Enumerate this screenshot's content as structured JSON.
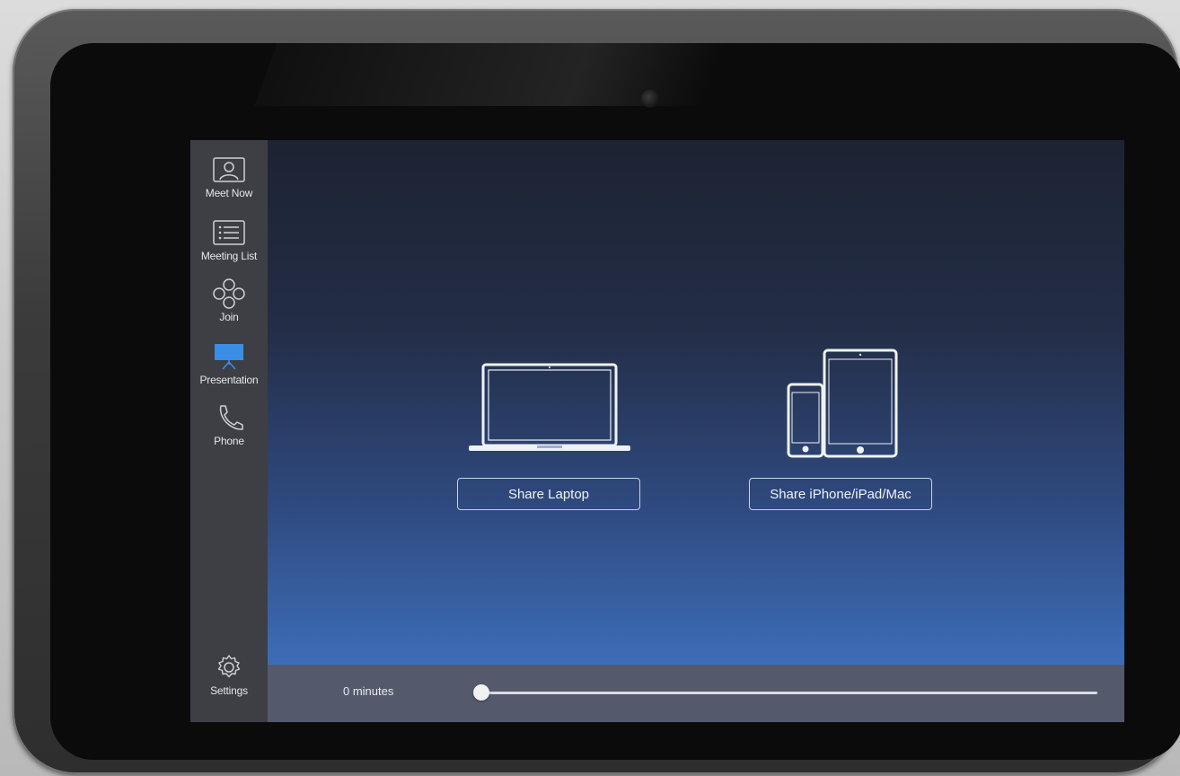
{
  "sidebar": {
    "items": [
      {
        "label": "Meet Now",
        "icon": "contact-card-icon",
        "active": false
      },
      {
        "label": "Meeting List",
        "icon": "list-icon",
        "active": false
      },
      {
        "label": "Join",
        "icon": "join-icon",
        "active": false
      },
      {
        "label": "Presentation",
        "icon": "presentation-screen-icon",
        "active": true
      },
      {
        "label": "Phone",
        "icon": "phone-icon",
        "active": false
      }
    ],
    "settings": {
      "label": "Settings",
      "icon": "gear-icon"
    }
  },
  "main": {
    "share_laptop_label": "Share Laptop",
    "share_mobile_label": "Share iPhone/iPad/Mac"
  },
  "bottom_bar": {
    "duration_text": "0 minutes",
    "slider_value": 0
  },
  "colors": {
    "active_icon": "#3a8ee6",
    "sidebar_bg": "#3d3f44",
    "bottom_bar_bg": "#545a6c"
  }
}
